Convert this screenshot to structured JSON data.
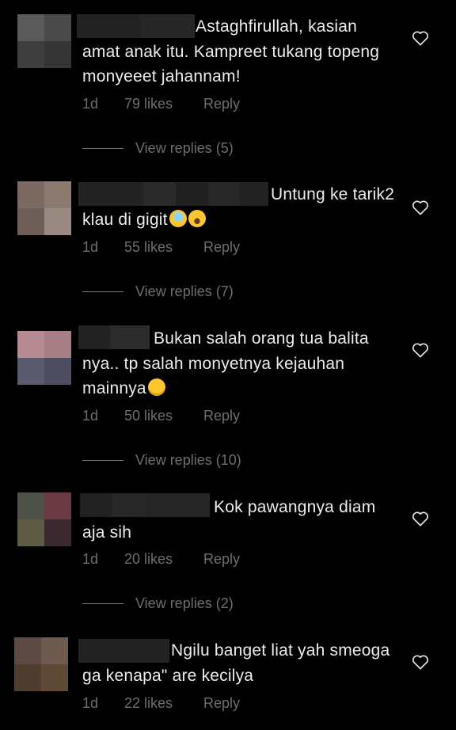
{
  "comments": [
    {
      "text_pre": "Astaghfirullah, kasian amat anak itu. Kampreet tukang topeng monyeeet jahannam!",
      "emojis": [],
      "age": "1d",
      "likes": "79 likes",
      "reply_label": "Reply",
      "view_replies": "View replies (5)"
    },
    {
      "text_pre": "Untung ke tarik2 klau di gigit",
      "emojis": [
        "face-screaming-in-fear",
        "loudly-crying-face"
      ],
      "age": "1d",
      "likes": "55 likes",
      "reply_label": "Reply",
      "view_replies": "View replies (7)"
    },
    {
      "text_pre": "Bukan salah orang tua balita nya.. tp salah monyetnya kejauhan mainnya",
      "emojis": [
        "face-with-rolling-eyes"
      ],
      "age": "1d",
      "likes": "50 likes",
      "reply_label": "Reply",
      "view_replies": "View replies (10)"
    },
    {
      "text_pre": "Kok pawangnya diam aja sih",
      "emojis": [],
      "age": "1d",
      "likes": "20 likes",
      "reply_label": "Reply",
      "view_replies": "View replies (2)"
    },
    {
      "text_pre": "Ngilu banget liat yah smeoga ga kenapa\" are kecilya",
      "emojis": [],
      "age": "1d",
      "likes": "22 likes",
      "reply_label": "Reply",
      "view_replies": ""
    }
  ],
  "colors": {
    "background": "#000000",
    "text": "#ececec",
    "meta": "#6e6e6e"
  },
  "icons": {
    "like": "heart-outline-icon"
  }
}
